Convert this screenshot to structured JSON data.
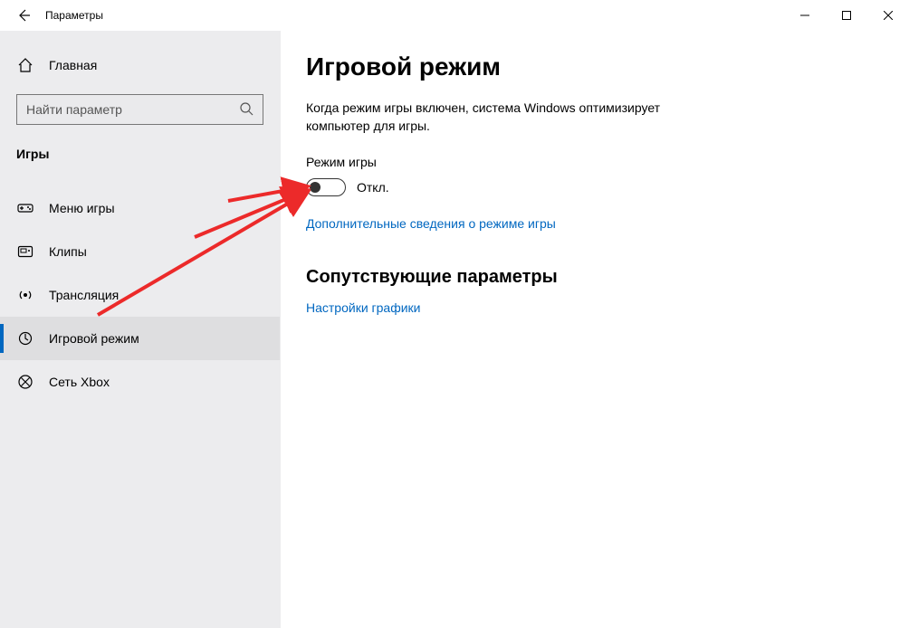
{
  "window": {
    "title": "Параметры"
  },
  "sidebar": {
    "home_label": "Главная",
    "search_placeholder": "Найти параметр",
    "category": "Игры",
    "items": [
      {
        "label": "Меню игры",
        "icon": "game-bar-icon"
      },
      {
        "label": "Клипы",
        "icon": "captures-icon"
      },
      {
        "label": "Трансляция",
        "icon": "broadcast-icon"
      },
      {
        "label": "Игровой режим",
        "icon": "game-mode-icon"
      },
      {
        "label": "Сеть Xbox",
        "icon": "xbox-icon"
      }
    ]
  },
  "main": {
    "title": "Игровой режим",
    "description": "Когда режим игры включен, система Windows оптимизирует компьютер для игры.",
    "toggle_label": "Режим игры",
    "toggle_state": "Откл.",
    "learn_more": "Дополнительные сведения о режиме игры",
    "related_heading": "Сопутствующие параметры",
    "related_link": "Настройки графики"
  }
}
